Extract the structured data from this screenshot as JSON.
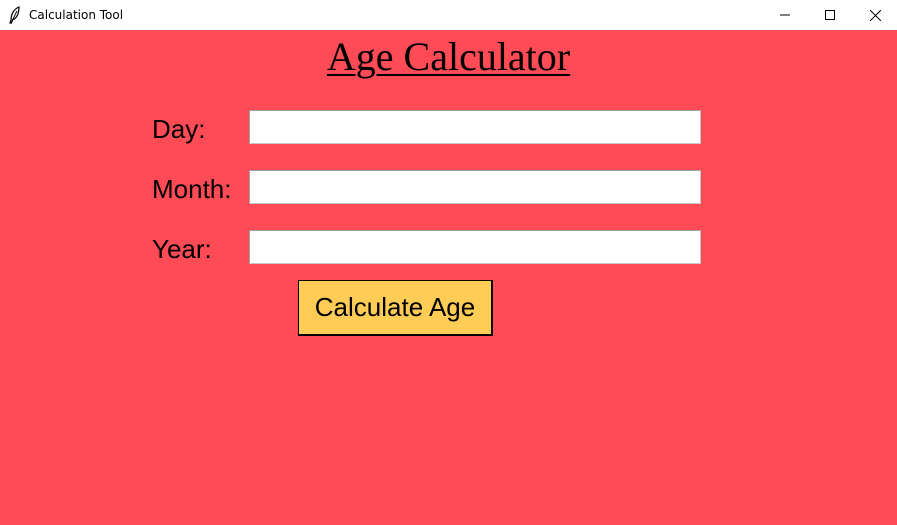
{
  "window": {
    "title": "Calculation Tool",
    "icon": "feather-icon",
    "controls": [
      "minimize-icon",
      "maximize-icon",
      "close-icon"
    ]
  },
  "colors": {
    "background": "#ff4b55",
    "button": "#ffcc55",
    "input": "#ffffff"
  },
  "main": {
    "heading": "Age Calculator",
    "fields": [
      {
        "label": "Day:",
        "value": ""
      },
      {
        "label": "Month:",
        "value": ""
      },
      {
        "label": "Year:",
        "value": ""
      }
    ],
    "button_label": "Calculate Age"
  }
}
